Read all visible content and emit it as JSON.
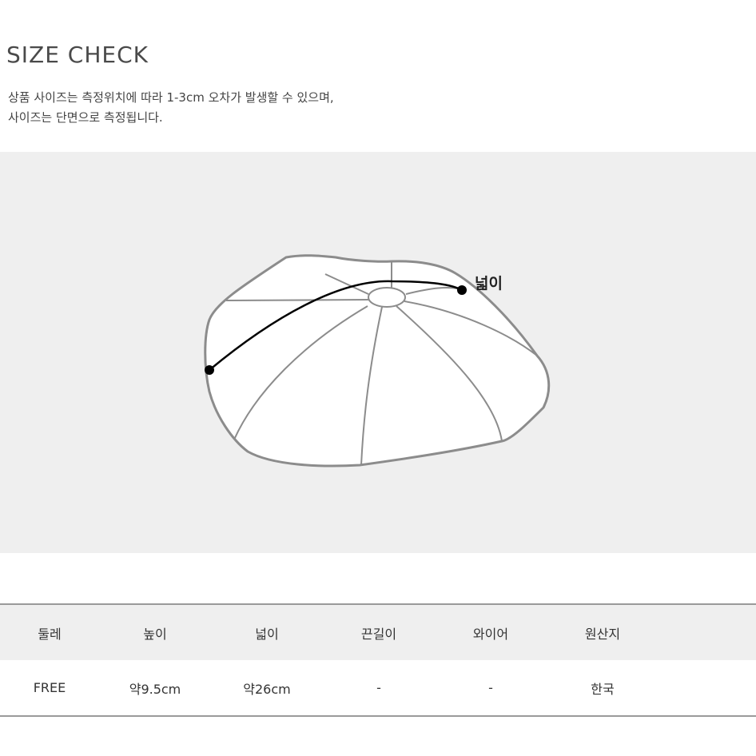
{
  "header": {
    "title": "SIZE CHECK",
    "description_lines": [
      "상품 사이즈는 측정위치에 따라 1-3cm 오차가 발생할 수 있으며,",
      "사이즈는 단면으로 측정됩니다."
    ]
  },
  "diagram": {
    "subject": "beret-hat-icon",
    "measurement_label": "넓이",
    "colors": {
      "panel_background": "#efefef",
      "hat_outline": "#8c8c8c",
      "hat_fill": "#ffffff",
      "measure_line": "#000000"
    }
  },
  "size_table": {
    "columns": [
      "둘레",
      "높이",
      "넓이",
      "끈길이",
      "와이어",
      "원산지"
    ],
    "rows": [
      [
        "FREE",
        "약9.5cm",
        "약26cm",
        "-",
        "-",
        "한국"
      ]
    ]
  }
}
